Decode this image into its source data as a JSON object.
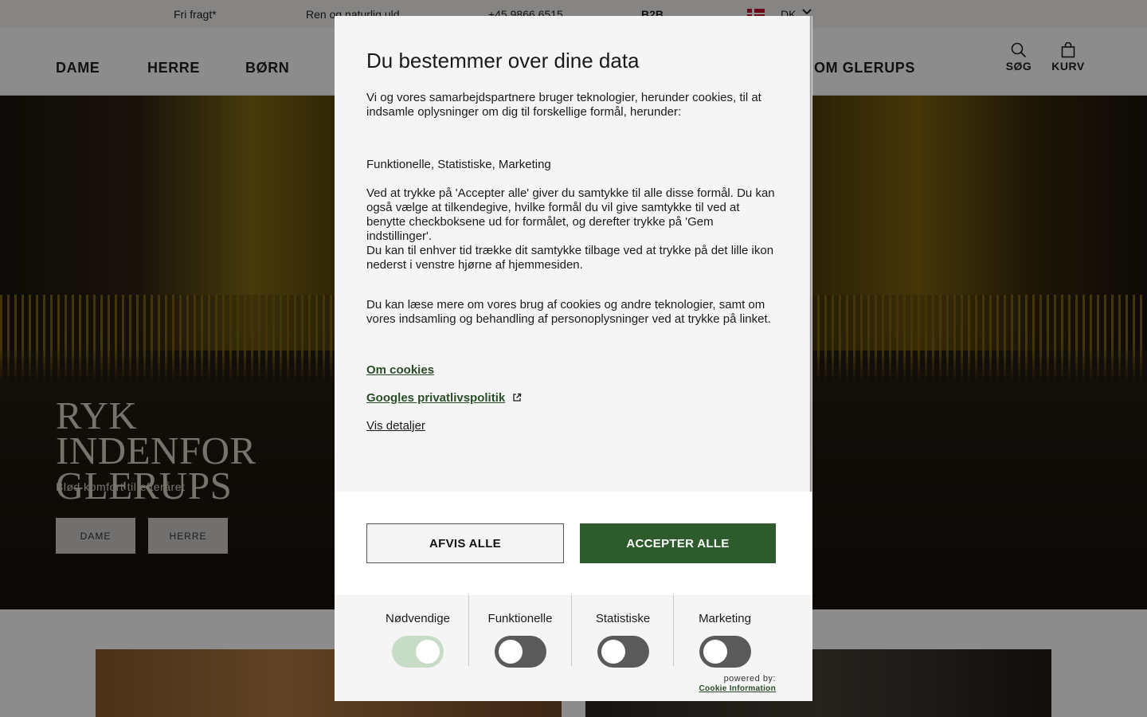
{
  "topbar": {
    "free_freight": "Fri fragt*",
    "natural": "Ren og naturlig uld",
    "phone": "+45 9866 6515",
    "b2b": "B2B",
    "language": "DK"
  },
  "nav": {
    "dame": "DAME",
    "herre": "HERRE",
    "born": "BØRN",
    "om": "OM GLERUPS",
    "search_label": "SØG",
    "cart_label": "KURV"
  },
  "hero": {
    "title": "RYK INDENFOR GLERUPS",
    "subtitle": "Blød komfort til efteråret",
    "button_dame": "DAME",
    "button_herre": "HERRE"
  },
  "cookie_dialog": {
    "title": "Du bestemmer over dine data",
    "intro": "Vi og vores samarbejdspartnere bruger teknologier, herunder cookies, til at indsamle oplysninger om dig til forskellige formål, herunder:",
    "purposes": "Funktionelle, Statistiske, Marketing",
    "consent_text_1": "Ved at trykke på 'Accepter alle' giver du samtykke til alle disse formål. Du kan også vælge at tilkendegive, hvilke formål du vil give samtykke til ved at benytte checkboksene ud for formålet, og derefter trykke på 'Gem indstillinger'.",
    "consent_text_2": "Du kan til enhver tid trække dit samtykke tilbage ved at trykke på det lille ikon nederst i venstre hjørne af hjemmesiden.",
    "read_more": "Du kan læse mere om vores brug af cookies og andre teknologier, samt om vores indsamling og behandling af personoplysninger ved at trykke på linket.",
    "link_about_cookies": "Om cookies",
    "link_google_privacy": "Googles privatlivspolitik",
    "link_details": "Vis detaljer",
    "button_reject": "AFVIS ALLE",
    "button_accept": "ACCEPTER ALLE",
    "toggles": [
      {
        "label": "Nødvendige",
        "state": "on",
        "locked": true
      },
      {
        "label": "Funktionelle",
        "state": "off"
      },
      {
        "label": "Statistiske",
        "state": "off"
      },
      {
        "label": "Marketing",
        "state": "off"
      }
    ],
    "powered_by": "powered by:",
    "powered_link": "Cookie Information"
  },
  "colors": {
    "accent_green": "#2d5b2b",
    "toggle_on": "#c6dcc6",
    "toggle_off": "#5a5a5a",
    "dialog_bg": "#f5f5f5"
  },
  "icons": {
    "search": "search-icon",
    "cart": "bag-icon",
    "language_chevron": "chevron-down-icon",
    "external_link": "external-link-icon"
  }
}
